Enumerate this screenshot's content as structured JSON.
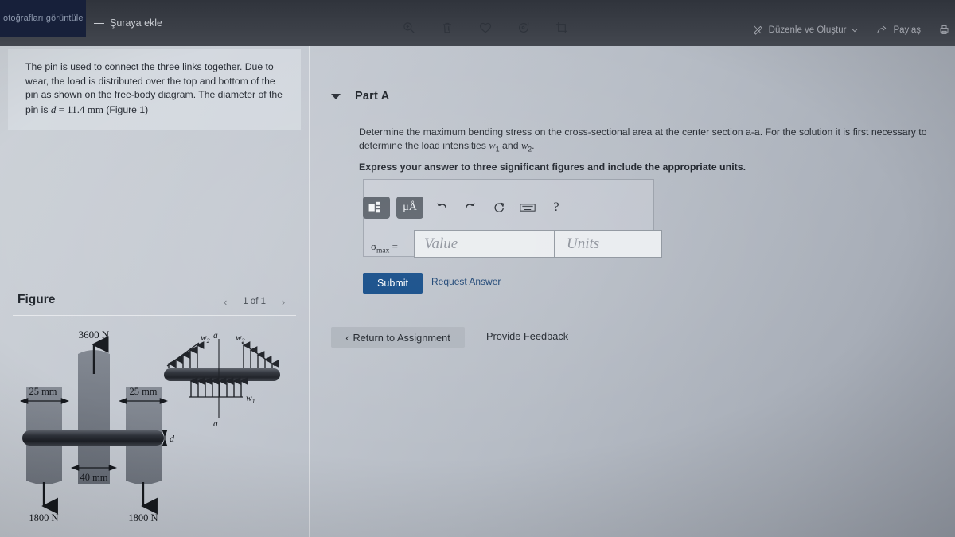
{
  "viewer": {
    "tab_label": "otoğrafları görüntüle",
    "add_to_label": "Şuraya ekle",
    "tools": [
      {
        "name": "zoom-in-icon",
        "label": "Yakınlaştır"
      },
      {
        "name": "delete-icon",
        "label": "Sil"
      },
      {
        "name": "favorite-icon",
        "label": "Favorilere ekle"
      },
      {
        "name": "rotate-icon",
        "label": "Döndür"
      },
      {
        "name": "crop-icon",
        "label": "Kırp"
      }
    ],
    "edit_create_label": "Düzenle ve Oluştur",
    "share_label": "Paylaş",
    "print_icon": "print-icon"
  },
  "problem": {
    "statement_part1": "The pin is used to connect the three links together. Due to wear, the load is distributed over the top and bottom of the pin as shown on the free-body diagram. The diameter of the pin is ",
    "d_symbol": "d",
    "d_equals": " = 11.4 ",
    "d_unit": "mm",
    "figure_ref": "(Figure 1)"
  },
  "figure": {
    "title": "Figure",
    "pager_prev": "‹",
    "pager_count": "1 of 1",
    "pager_next": "›",
    "labels": {
      "top_force": "3600 N",
      "left_dim": "25 mm",
      "right_dim": "25 mm",
      "center_dim": "40 mm",
      "diameter": "d",
      "bottom_left_force": "1800 N",
      "bottom_right_force": "1800 N",
      "w2_left": "w",
      "w2_left_sub": "2",
      "w2_right": "w",
      "w2_right_sub": "2",
      "w1": "w",
      "w1_sub": "1",
      "section_top": "a",
      "section_bottom": "a"
    }
  },
  "part_a": {
    "label": "Part A",
    "question_line1": "Determine the maximum bending stress on the cross-sectional area at the center section a-a. For the solution it is first necessary",
    "question_line2_pre": "to determine the load intensities ",
    "question_w1": "w",
    "question_w1_sub": "1",
    "question_and": " and ",
    "question_w2": "w",
    "question_w2_sub": "2",
    "question_end": ".",
    "express_instruction": "Express your answer to three significant figures and include the appropriate units.",
    "answer": {
      "symbol": "σ",
      "symbol_sub": "max",
      "equals": "=",
      "value_placeholder": "Value",
      "units_placeholder": "Units",
      "toolbar": [
        {
          "name": "template-icon",
          "label": "Templates"
        },
        {
          "name": "units-icon",
          "label": "μÅ"
        },
        {
          "name": "undo-icon",
          "label": "Undo"
        },
        {
          "name": "redo-icon",
          "label": "Redo"
        },
        {
          "name": "reset-icon",
          "label": "Reset"
        },
        {
          "name": "keyboard-icon",
          "label": "Keyboard shortcuts"
        },
        {
          "name": "help-icon",
          "label": "?"
        }
      ]
    },
    "submit_label": "Submit",
    "request_answer_label": "Request Answer"
  },
  "footer": {
    "return_label": "Return to Assignment",
    "return_chevron": "‹",
    "feedback_label": "Provide Feedback"
  },
  "colors": {
    "submit_blue": "#0d4785",
    "link_blue": "#123c6e",
    "tab_navy": "#17203a",
    "page_bg": "#c4c9d1"
  }
}
